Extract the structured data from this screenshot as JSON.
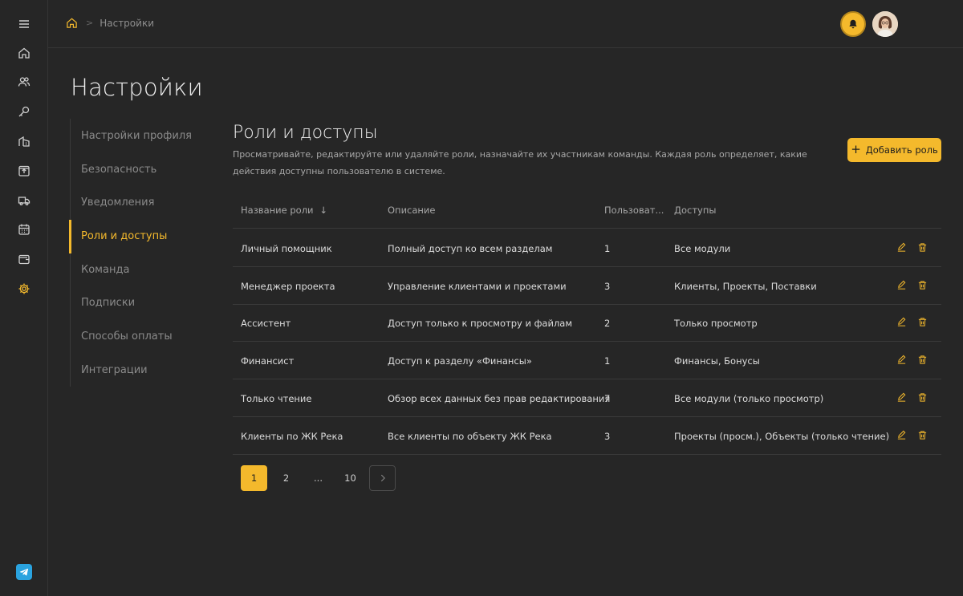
{
  "colors": {
    "accent": "#f4b92c",
    "background": "#262626",
    "telegram": "#2aa3df"
  },
  "rail": {
    "items": [
      {
        "name": "menu-icon"
      },
      {
        "name": "home-icon"
      },
      {
        "name": "users-icon"
      },
      {
        "name": "key-icon"
      },
      {
        "name": "building-icon"
      },
      {
        "name": "upload-box-icon"
      },
      {
        "name": "truck-icon"
      },
      {
        "name": "calendar-icon"
      },
      {
        "name": "wallet-icon"
      },
      {
        "name": "gear-icon",
        "active": true
      }
    ],
    "bottom": "telegram-icon"
  },
  "breadcrumb": {
    "current": "Настройки"
  },
  "page": {
    "title": "Настройки"
  },
  "subnav": {
    "items": [
      {
        "label": "Настройки профиля"
      },
      {
        "label": "Безопасность"
      },
      {
        "label": "Уведомления"
      },
      {
        "label": "Роли и доступы",
        "active": true
      },
      {
        "label": "Команда"
      },
      {
        "label": "Подписки"
      },
      {
        "label": "Способы оплаты"
      },
      {
        "label": "Интеграции"
      }
    ]
  },
  "section": {
    "title": "Роли и доступы",
    "description": "Просматривайте, редактируйте или удаляйте роли, назначайте их участникам команды. Каждая роль определяет, какие действия доступны пользователю в системе.",
    "add_button": "Добавить роль"
  },
  "table": {
    "headers": {
      "name": "Название роли",
      "sort_glyph": "↓",
      "description": "Описание",
      "users": "Пользоват...",
      "access": "Доступы"
    },
    "rows": [
      {
        "name": "Личный помощник",
        "description": "Полный доступ ко всем разделам",
        "users": "1",
        "access": "Все модули"
      },
      {
        "name": "Менеджер проекта",
        "description": "Управление клиентами и проектами",
        "users": "3",
        "access": "Клиенты, Проекты, Поставки"
      },
      {
        "name": "Ассистент",
        "description": "Доступ только к просмотру и файлам",
        "users": "2",
        "access": "Только просмотр"
      },
      {
        "name": "Финансист",
        "description": "Доступ к разделу «Финансы»",
        "users": "1",
        "access": "Финансы, Бонусы"
      },
      {
        "name": "Только чтение",
        "description": "Обзор всех данных без прав редактирования",
        "users": "7",
        "access": "Все модули (только просмотр)"
      },
      {
        "name": "Клиенты по ЖК Река",
        "description": "Все клиенты по объекту ЖК Река",
        "users": "3",
        "access": "Проекты (просм.), Объекты (только чтение)"
      }
    ]
  },
  "pagination": {
    "pages": [
      "1",
      "2",
      "...",
      "10"
    ],
    "current": "1"
  }
}
